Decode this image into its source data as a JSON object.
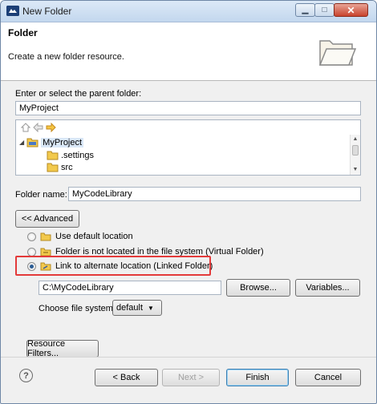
{
  "window": {
    "title": "New Folder",
    "minimize_glyph": "▁",
    "maximize_glyph": "□",
    "close_glyph": "✕"
  },
  "header": {
    "title": "Folder",
    "description": "Create a new folder resource."
  },
  "parent": {
    "label": "Enter or select the parent folder:",
    "value": "MyProject"
  },
  "tree": {
    "toolbar": [
      "home-icon",
      "back-icon",
      "forward-icon"
    ],
    "items": [
      {
        "label": "MyProject",
        "expanded": true,
        "icon": "project-icon"
      },
      {
        "label": ".settings",
        "icon": "folder-icon"
      },
      {
        "label": "src",
        "icon": "folder-icon"
      }
    ]
  },
  "folder_name": {
    "label": "Folder name:",
    "value": "MyCodeLibrary"
  },
  "advanced_button": "<< Advanced",
  "location_options": [
    {
      "label": "Use default location",
      "checked": false
    },
    {
      "label": "Folder is not located in the file system (Virtual Folder)",
      "checked": false
    },
    {
      "label": "Link to alternate location (Linked Folder)",
      "checked": true
    }
  ],
  "linked_location": {
    "path": "C:\\MyCodeLibrary",
    "browse_label": "Browse...",
    "variables_label": "Variables..."
  },
  "file_system": {
    "label": "Choose file system:",
    "selected": "default"
  },
  "resource_filters_label": "Resource Filters...",
  "footer": {
    "help_glyph": "?",
    "back_label": "< Back",
    "next_label": "Next >",
    "finish_label": "Finish",
    "cancel_label": "Cancel"
  },
  "colors": {
    "highlight_border": "#e33a3a",
    "folder_yellow": "#f2c94c"
  }
}
